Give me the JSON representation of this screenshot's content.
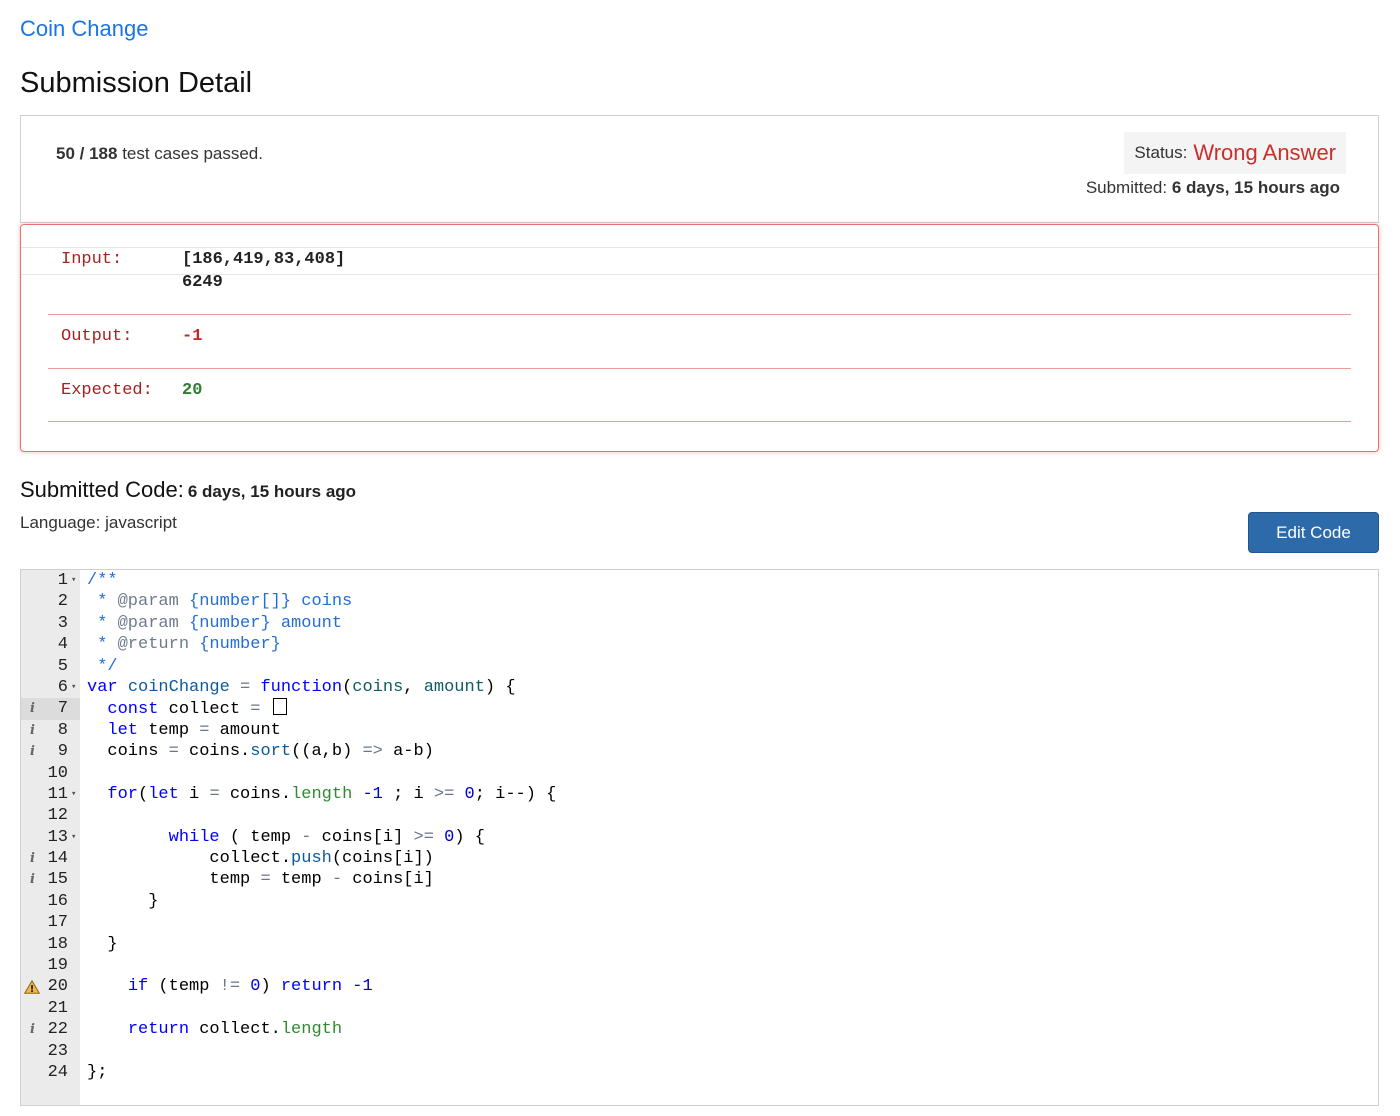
{
  "problem_link": "Coin Change",
  "page_title": "Submission Detail",
  "summary": {
    "passed": "50 / 188",
    "passed_suffix": "test cases passed.",
    "status_label": "Status:",
    "status_value": "Wrong Answer",
    "submitted_label": "Submitted:",
    "submitted_value": "6 days, 15 hours ago"
  },
  "result": {
    "input_label": "Input:",
    "input_line1": "[186,419,83,408]",
    "input_line2": "6249",
    "output_label": "Output:",
    "output_value": "-1",
    "expected_label": "Expected:",
    "expected_value": "20"
  },
  "code_section": {
    "title": "Submitted Code:",
    "when": "6 days, 15 hours ago",
    "language_line": "Language: javascript",
    "edit_button": "Edit Code"
  },
  "colors": {
    "link": "#1a73e8",
    "status_wrong": "#c9302c",
    "expected_green": "#2e7d32",
    "button_bg": "#2c6aaa"
  },
  "editor": {
    "active_line": 7,
    "lines": [
      {
        "n": "1",
        "fold": true,
        "ann": "",
        "code": [
          [
            "cm",
            "/**"
          ]
        ]
      },
      {
        "n": "2",
        "fold": false,
        "ann": "",
        "code": [
          [
            "cm",
            " * "
          ],
          [
            "doc",
            "@param"
          ],
          [
            "cm",
            " {number[]} coins"
          ]
        ]
      },
      {
        "n": "3",
        "fold": false,
        "ann": "",
        "code": [
          [
            "cm",
            " * "
          ],
          [
            "doc",
            "@param"
          ],
          [
            "cm",
            " {number} amount"
          ]
        ]
      },
      {
        "n": "4",
        "fold": false,
        "ann": "",
        "code": [
          [
            "cm",
            " * "
          ],
          [
            "doc",
            "@return"
          ],
          [
            "cm",
            " {number}"
          ]
        ]
      },
      {
        "n": "5",
        "fold": false,
        "ann": "",
        "code": [
          [
            "cm",
            " */"
          ]
        ]
      },
      {
        "n": "6",
        "fold": true,
        "ann": "",
        "code": [
          [
            "kw",
            "var"
          ],
          [
            "",
            " "
          ],
          [
            "fn",
            "coinChange"
          ],
          [
            "",
            " "
          ],
          [
            "op",
            "="
          ],
          [
            "",
            " "
          ],
          [
            "kw",
            "function"
          ],
          [
            "",
            "("
          ],
          [
            "pa",
            "coins"
          ],
          [
            "",
            ", "
          ],
          [
            "pa",
            "amount"
          ],
          [
            "",
            ") {"
          ]
        ]
      },
      {
        "n": "7",
        "fold": false,
        "ann": "i",
        "code": [
          [
            "",
            "  "
          ],
          [
            "kw",
            "const"
          ],
          [
            "",
            " collect "
          ],
          [
            "op",
            "="
          ],
          [
            "",
            " "
          ],
          [
            "cursor",
            "[]"
          ]
        ]
      },
      {
        "n": "8",
        "fold": false,
        "ann": "i",
        "code": [
          [
            "",
            "  "
          ],
          [
            "kw",
            "let"
          ],
          [
            "",
            " temp "
          ],
          [
            "op",
            "="
          ],
          [
            "",
            " amount"
          ]
        ]
      },
      {
        "n": "9",
        "fold": false,
        "ann": "i",
        "code": [
          [
            "",
            "  coins "
          ],
          [
            "op",
            "="
          ],
          [
            "",
            " coins."
          ],
          [
            "fn",
            "sort"
          ],
          [
            "",
            "((a,b) "
          ],
          [
            "op",
            "=>"
          ],
          [
            "",
            " a-b)"
          ]
        ]
      },
      {
        "n": "10",
        "fold": false,
        "ann": "",
        "code": []
      },
      {
        "n": "11",
        "fold": true,
        "ann": "",
        "code": [
          [
            "",
            "  "
          ],
          [
            "kw",
            "for"
          ],
          [
            "",
            "("
          ],
          [
            "kw",
            "let"
          ],
          [
            "",
            " i "
          ],
          [
            "op",
            "="
          ],
          [
            "",
            " coins."
          ],
          [
            "pr",
            "length"
          ],
          [
            "",
            " "
          ],
          [
            "nu",
            "-1"
          ],
          [
            "",
            " ; i "
          ],
          [
            "op",
            ">="
          ],
          [
            "",
            " "
          ],
          [
            "nu",
            "0"
          ],
          [
            "",
            "; i--) {"
          ]
        ]
      },
      {
        "n": "12",
        "fold": false,
        "ann": "",
        "code": []
      },
      {
        "n": "13",
        "fold": true,
        "ann": "",
        "code": [
          [
            "",
            "        "
          ],
          [
            "kw",
            "while"
          ],
          [
            "",
            " ( temp "
          ],
          [
            "op",
            "-"
          ],
          [
            "",
            " coins[i] "
          ],
          [
            "op",
            ">="
          ],
          [
            "",
            " "
          ],
          [
            "nu",
            "0"
          ],
          [
            "",
            ") {"
          ]
        ]
      },
      {
        "n": "14",
        "fold": false,
        "ann": "i",
        "code": [
          [
            "",
            "            collect."
          ],
          [
            "fn",
            "push"
          ],
          [
            "",
            "(coins[i])"
          ]
        ]
      },
      {
        "n": "15",
        "fold": false,
        "ann": "i",
        "code": [
          [
            "",
            "            temp "
          ],
          [
            "op",
            "="
          ],
          [
            "",
            " temp "
          ],
          [
            "op",
            "-"
          ],
          [
            "",
            " coins[i]"
          ]
        ]
      },
      {
        "n": "16",
        "fold": false,
        "ann": "",
        "code": [
          [
            "",
            "      }"
          ]
        ]
      },
      {
        "n": "17",
        "fold": false,
        "ann": "",
        "code": []
      },
      {
        "n": "18",
        "fold": false,
        "ann": "",
        "code": [
          [
            "",
            "  }"
          ]
        ]
      },
      {
        "n": "19",
        "fold": false,
        "ann": "",
        "code": []
      },
      {
        "n": "20",
        "fold": false,
        "ann": "warn",
        "code": [
          [
            "",
            "    "
          ],
          [
            "kw",
            "if"
          ],
          [
            "",
            " (temp "
          ],
          [
            "op",
            "!="
          ],
          [
            "",
            " "
          ],
          [
            "nu",
            "0"
          ],
          [
            "",
            ") "
          ],
          [
            "kw",
            "return"
          ],
          [
            "",
            " "
          ],
          [
            "nu",
            "-1"
          ]
        ]
      },
      {
        "n": "21",
        "fold": false,
        "ann": "",
        "code": []
      },
      {
        "n": "22",
        "fold": false,
        "ann": "i",
        "code": [
          [
            "",
            "    "
          ],
          [
            "kw",
            "return"
          ],
          [
            "",
            " collect."
          ],
          [
            "pr",
            "length"
          ]
        ]
      },
      {
        "n": "23",
        "fold": false,
        "ann": "",
        "code": []
      },
      {
        "n": "24",
        "fold": false,
        "ann": "",
        "code": [
          [
            "",
            "};"
          ]
        ]
      }
    ]
  }
}
